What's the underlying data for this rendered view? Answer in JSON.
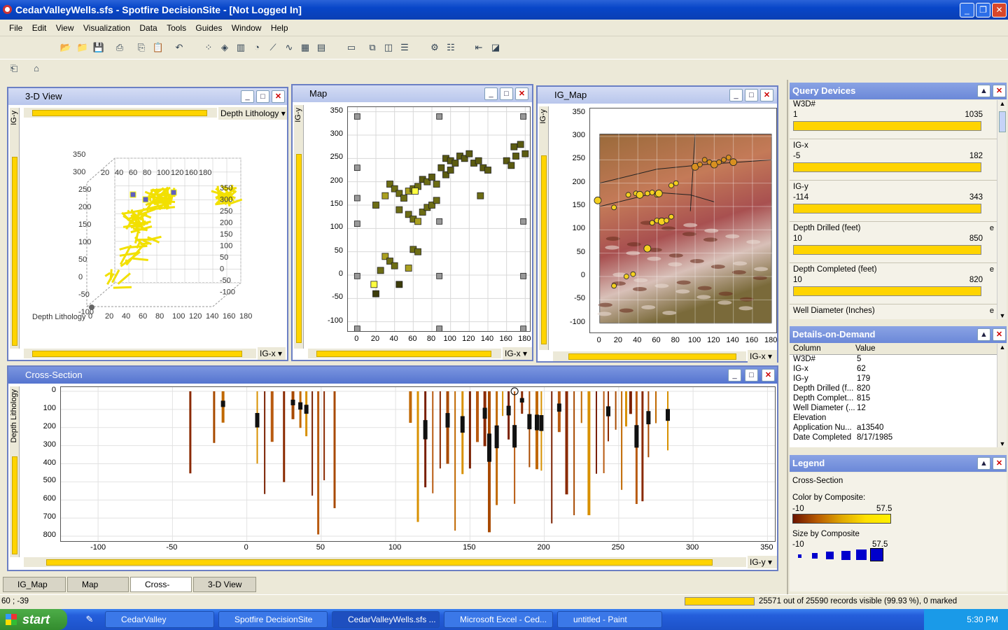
{
  "app": {
    "title": "CedarValleyWells.sfs - Spotfire DecisionSite - [Not Logged In]"
  },
  "menu": [
    "File",
    "Edit",
    "View",
    "Visualization",
    "Data",
    "Tools",
    "Guides",
    "Window",
    "Help"
  ],
  "panels": {
    "view3d": {
      "title": "3-D View",
      "color_by": "Depth Lithology",
      "y_axis": "IG-y",
      "x_axis": "IG-x",
      "z_label": "Depth Lithology"
    },
    "map": {
      "title": "Map",
      "y_axis": "IG-y",
      "x_axis": "IG-x"
    },
    "igmap": {
      "title": "IG_Map",
      "y_axis": "IG-y",
      "x_axis": "IG-x"
    },
    "cross": {
      "title": "Cross-Section",
      "y_axis": "Depth Lithology",
      "x_axis": "IG-y"
    }
  },
  "chart_data": [
    {
      "type": "scatter",
      "title": "Map",
      "xlabel": "IG-x",
      "ylabel": "IG-y",
      "xlim": [
        -10,
        185
      ],
      "ylim": [
        -120,
        360
      ],
      "x_ticks": [
        "0",
        "20",
        "40",
        "60",
        "80",
        "100",
        "120",
        "140",
        "160",
        "180"
      ],
      "y_ticks": [
        "350",
        "300",
        "250",
        "200",
        "150",
        "100",
        "50",
        "0",
        "-50",
        "-100"
      ],
      "points": [
        [
          0,
          340
        ],
        [
          88,
          340
        ],
        [
          178,
          340
        ],
        [
          0,
          230
        ],
        [
          0,
          165
        ],
        [
          0,
          110
        ],
        [
          88,
          115
        ],
        [
          178,
          115
        ],
        [
          0,
          -2
        ],
        [
          88,
          -2
        ],
        [
          178,
          -2
        ],
        [
          0,
          -115
        ],
        [
          88,
          -115
        ],
        [
          178,
          -115
        ],
        [
          20,
          150
        ],
        [
          30,
          170
        ],
        [
          35,
          195
        ],
        [
          40,
          185
        ],
        [
          45,
          175
        ],
        [
          50,
          165
        ],
        [
          55,
          180
        ],
        [
          60,
          185
        ],
        [
          65,
          190
        ],
        [
          70,
          205
        ],
        [
          75,
          200
        ],
        [
          80,
          210
        ],
        [
          85,
          195
        ],
        [
          45,
          140
        ],
        [
          55,
          130
        ],
        [
          60,
          120
        ],
        [
          65,
          115
        ],
        [
          70,
          135
        ],
        [
          75,
          145
        ],
        [
          80,
          150
        ],
        [
          85,
          160
        ],
        [
          90,
          230
        ],
        [
          95,
          250
        ],
        [
          100,
          245
        ],
        [
          105,
          240
        ],
        [
          110,
          255
        ],
        [
          115,
          250
        ],
        [
          120,
          260
        ],
        [
          125,
          240
        ],
        [
          130,
          245
        ],
        [
          135,
          230
        ],
        [
          140,
          225
        ],
        [
          95,
          215
        ],
        [
          100,
          225
        ],
        [
          132,
          170
        ],
        [
          160,
          245
        ],
        [
          165,
          235
        ],
        [
          170,
          255
        ],
        [
          175,
          280
        ],
        [
          180,
          260
        ],
        [
          168,
          275
        ],
        [
          30,
          40
        ],
        [
          35,
          30
        ],
        [
          40,
          20
        ],
        [
          45,
          -20
        ],
        [
          25,
          10
        ],
        [
          55,
          15
        ],
        [
          60,
          55
        ],
        [
          65,
          50
        ],
        [
          20,
          -40
        ],
        [
          18,
          -20
        ],
        [
          62,
          180
        ]
      ]
    },
    {
      "type": "scatter",
      "title": "IG_Map",
      "xlabel": "IG-x",
      "ylabel": "IG-y",
      "xlim": [
        -10,
        185
      ],
      "ylim": [
        -120,
        360
      ],
      "x_ticks": [
        "0",
        "20",
        "40",
        "60",
        "80",
        "100",
        "120",
        "140",
        "160",
        "180"
      ],
      "y_ticks": [
        "350",
        "300",
        "250",
        "200",
        "150",
        "100",
        "50",
        "0",
        "-50",
        "-100"
      ],
      "points": [
        [
          -2,
          163
        ],
        [
          15,
          148
        ],
        [
          30,
          175
        ],
        [
          38,
          178
        ],
        [
          42,
          175
        ],
        [
          50,
          178
        ],
        [
          55,
          180
        ],
        [
          60,
          175
        ],
        [
          62,
          178
        ],
        [
          75,
          195
        ],
        [
          80,
          200
        ],
        [
          60,
          120
        ],
        [
          65,
          118
        ],
        [
          70,
          120
        ],
        [
          75,
          128
        ],
        [
          55,
          115
        ],
        [
          50,
          60
        ],
        [
          28,
          0
        ],
        [
          35,
          5
        ],
        [
          15,
          -20
        ],
        [
          100,
          235
        ],
        [
          105,
          240
        ],
        [
          110,
          250
        ],
        [
          115,
          245
        ],
        [
          120,
          240
        ],
        [
          125,
          245
        ],
        [
          130,
          250
        ],
        [
          135,
          255
        ],
        [
          140,
          245
        ]
      ]
    },
    {
      "type": "bar",
      "title": "Cross-Section",
      "xlabel": "IG-y",
      "ylabel": "Depth Lithology",
      "xlim": [
        -125,
        355
      ],
      "ylim": [
        850,
        0
      ],
      "x_ticks": [
        "-100",
        "-50",
        "0",
        "50",
        "100",
        "150",
        "200",
        "250",
        "300",
        "350"
      ],
      "y_ticks": [
        "0",
        "100",
        "200",
        "300",
        "400",
        "500",
        "600",
        "700",
        "800"
      ]
    },
    {
      "type": "scatter",
      "title": "3-D View",
      "xlabel": "IG-x",
      "ylabel": "IG-y",
      "zlabel": "Depth Lithology",
      "x_ticks": [
        "0",
        "20",
        "40",
        "60",
        "80",
        "100",
        "120",
        "140",
        "160",
        "180"
      ],
      "y_ticks": [
        "350",
        "300",
        "250",
        "200",
        "150",
        "100",
        "50",
        "0",
        "-50",
        "-100"
      ],
      "top_ticks": [
        "20",
        "40",
        "60",
        "80",
        "100",
        "120",
        "160",
        "180"
      ],
      "right_ticks": [
        "350",
        "300",
        "250",
        "200",
        "150",
        "100",
        "50",
        "0",
        "-50",
        "-100"
      ]
    }
  ],
  "query_devices": {
    "title": "Query Devices",
    "items": [
      {
        "name": "W3D#",
        "lo": "1",
        "hi": "1035",
        "e": ""
      },
      {
        "name": "IG-x",
        "lo": "-5",
        "hi": "182",
        "e": ""
      },
      {
        "name": "IG-y",
        "lo": "-114",
        "hi": "343",
        "e": ""
      },
      {
        "name": "Depth Drilled (feet)",
        "lo": "10",
        "hi": "850",
        "e": "e"
      },
      {
        "name": "Depth Completed (feet)",
        "lo": "10",
        "hi": "820",
        "e": "e"
      },
      {
        "name": "Well Diameter (Inches)",
        "lo": "",
        "hi": "",
        "e": "e"
      }
    ]
  },
  "details": {
    "title": "Details-on-Demand",
    "col_header": "Column",
    "val_header": "Value",
    "rows": [
      [
        "W3D#",
        "5"
      ],
      [
        "IG-x",
        "62"
      ],
      [
        "IG-y",
        "179"
      ],
      [
        "Depth Drilled (f...",
        "820"
      ],
      [
        "Depth Complet...",
        "815"
      ],
      [
        "Well Diameter (...",
        "12"
      ],
      [
        "Elevation",
        ""
      ],
      [
        "Application Nu...",
        "a13540"
      ],
      [
        "Date Completed",
        "8/17/1985"
      ]
    ]
  },
  "legend": {
    "title": "Legend",
    "subtitle": "Cross-Section",
    "color_label": "Color by Composite:",
    "color_min": "-10",
    "color_max": "57.5",
    "size_label": "Size by Composite",
    "size_min": "-10",
    "size_max": "57.5"
  },
  "tabs": [
    "IG_Map",
    "Map",
    "Cross-Section",
    "3-D View"
  ],
  "status": {
    "coords": "60 ; -39",
    "records": "25571 out of 25590 records visible (99.93 %), 0 marked"
  },
  "taskbar": {
    "start": "start",
    "items": [
      "CedarValley",
      "Spotfire DecisionSite",
      "CedarValleyWells.sfs ...",
      "Microsoft Excel - Ced...",
      "untitled - Paint"
    ],
    "time": "5:30 PM"
  }
}
